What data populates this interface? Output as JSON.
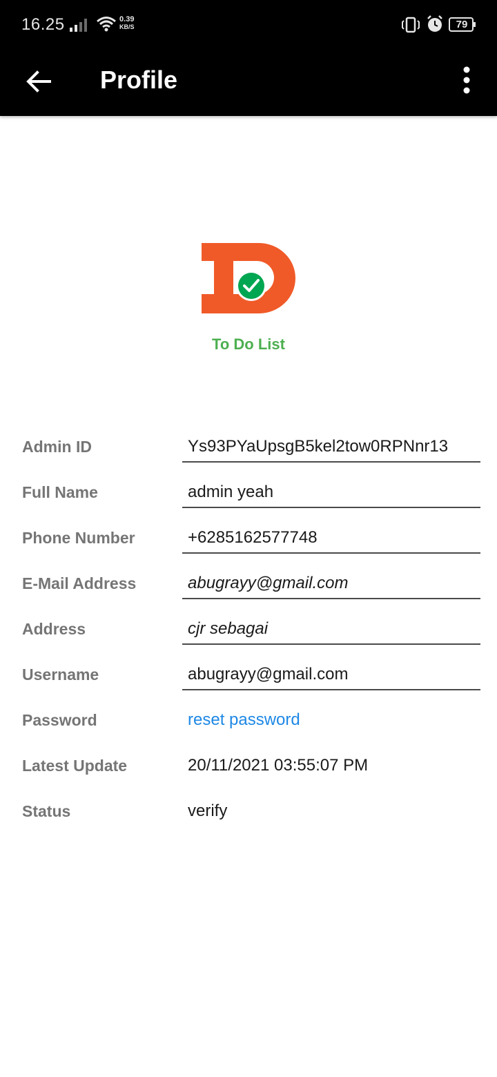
{
  "status_bar": {
    "time": "16.25",
    "net_speed_value": "0.39",
    "net_speed_unit": "KB/S",
    "battery": "79"
  },
  "app_bar": {
    "title": "Profile"
  },
  "logo": {
    "caption": "To Do List",
    "brand_color": "#f05a28",
    "check_color": "#00a651"
  },
  "profile": {
    "admin_id": {
      "label": "Admin ID",
      "value": "Ys93PYaUpsgB5kel2tow0RPNnr13"
    },
    "full_name": {
      "label": "Full Name",
      "value": "admin yeah"
    },
    "phone": {
      "label": "Phone Number",
      "value": "+6285162577748"
    },
    "email": {
      "label": "E-Mail Address",
      "value": "abugrayy@gmail.com"
    },
    "address": {
      "label": "Address",
      "value": "cjr sebagai"
    },
    "username": {
      "label": "Username",
      "value": "abugrayy@gmail.com"
    },
    "password": {
      "label": "Password",
      "value": "reset password"
    },
    "latest_update": {
      "label": "Latest Update",
      "value": "20/11/2021 03:55:07 PM"
    },
    "status": {
      "label": "Status",
      "value": "verify"
    }
  },
  "colors": {
    "app_bar": "#000000",
    "label": "#757575",
    "link": "#1e88e5",
    "caption": "#4caf50"
  }
}
